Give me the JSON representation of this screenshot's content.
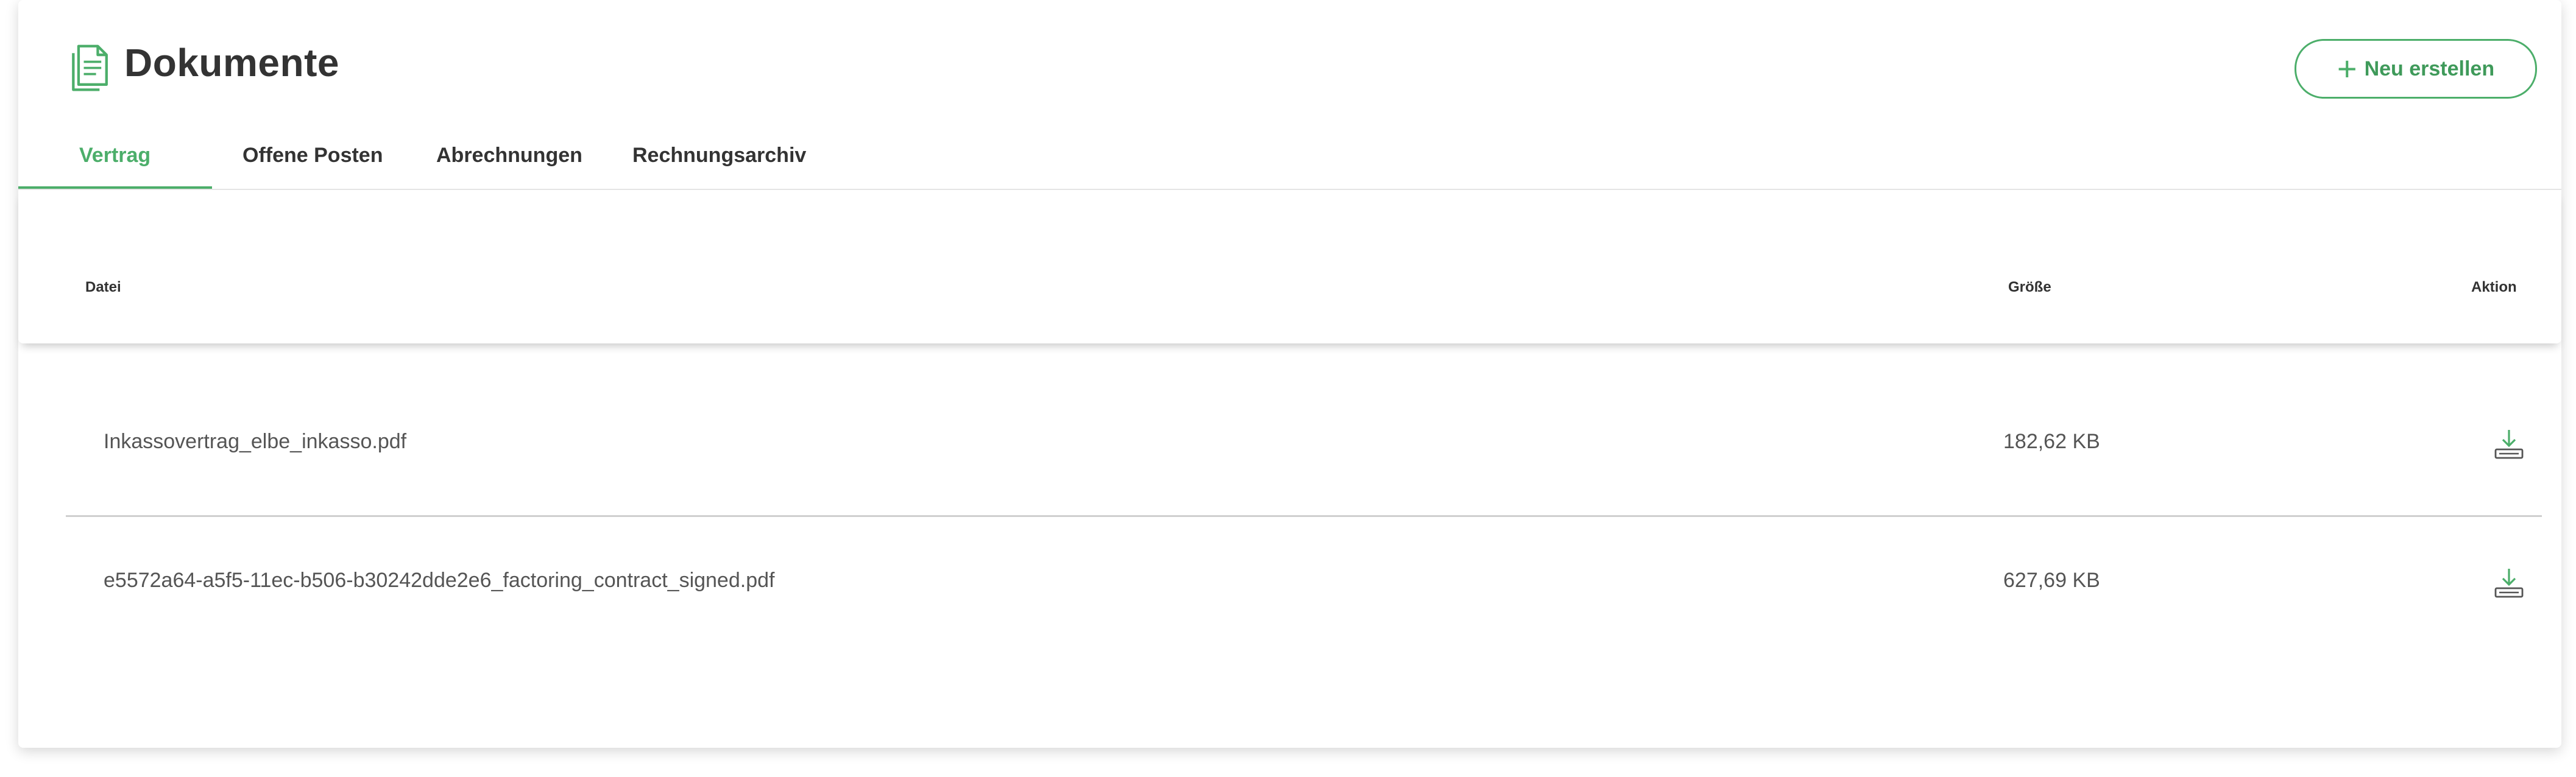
{
  "page": {
    "title": "Dokumente",
    "icon": "document-icon"
  },
  "header": {
    "new_button_label": "Neu erstellen",
    "new_button_icon": "plus-icon"
  },
  "tabs": [
    {
      "label": "Vertrag",
      "active": true
    },
    {
      "label": "Offene Posten",
      "active": false
    },
    {
      "label": "Abrechnungen",
      "active": false
    },
    {
      "label": "Rechnungsarchiv",
      "active": false
    }
  ],
  "table": {
    "columns": {
      "file": "Datei",
      "size": "Größe",
      "action": "Aktion"
    },
    "rows": [
      {
        "file": "Inkassovertrag_elbe_inkasso.pdf",
        "size": "182,62 KB",
        "action_icon": "download-icon"
      },
      {
        "file": "e5572a64-a5f5-11ec-b506-b30242dde2e6_factoring_contract_signed.pdf",
        "size": "627,69 KB",
        "action_icon": "download-icon"
      }
    ]
  },
  "colors": {
    "accent": "#4cae6a",
    "text": "#333333",
    "muted_text": "#555555"
  }
}
